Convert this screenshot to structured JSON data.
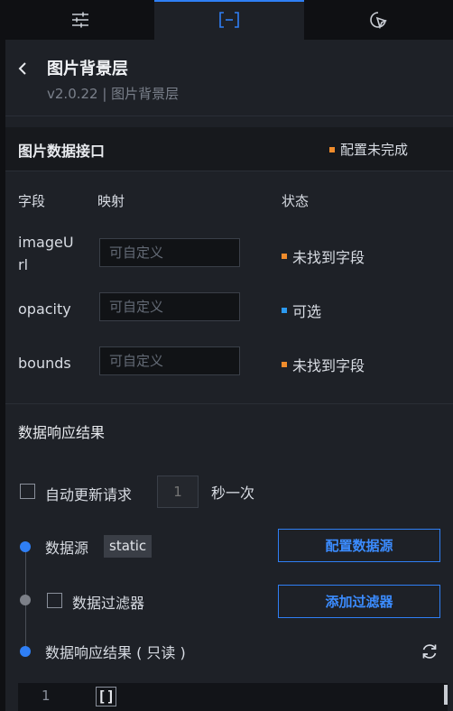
{
  "header": {
    "title": "图片背景层",
    "subtitle": "v2.0.22 | 图片背景层"
  },
  "data_interface": {
    "title": "图片数据接口",
    "status": "配置未完成",
    "columns": {
      "field": "字段",
      "mapping": "映射",
      "status": "状态"
    },
    "fields": [
      {
        "name": "imageU",
        "name2": "rl",
        "placeholder": "可自定义",
        "status": "未找到字段",
        "status_color": "#f08c2c"
      },
      {
        "name": "opacity",
        "placeholder": "可自定义",
        "status": "可选",
        "status_color": "#2c9af0"
      },
      {
        "name": "bounds",
        "placeholder": "可自定义",
        "status": "未找到字段",
        "status_color": "#f08c2c"
      }
    ]
  },
  "response": {
    "title": "数据响应结果",
    "auto_update_label": "自动更新请求",
    "interval_placeholder": "1",
    "interval_unit": "秒一次",
    "datasource_label": "数据源",
    "datasource_tag": "static",
    "configure_button": "配置数据源",
    "filter_label": "数据过滤器",
    "add_filter_button": "添加过滤器",
    "result_label": "数据响应结果 ( 只读 )",
    "code_line_number": "1",
    "code_content": "[]"
  },
  "colors": {
    "accent": "#2f7ff5",
    "warning": "#f08c2c",
    "info": "#2c9af0"
  }
}
